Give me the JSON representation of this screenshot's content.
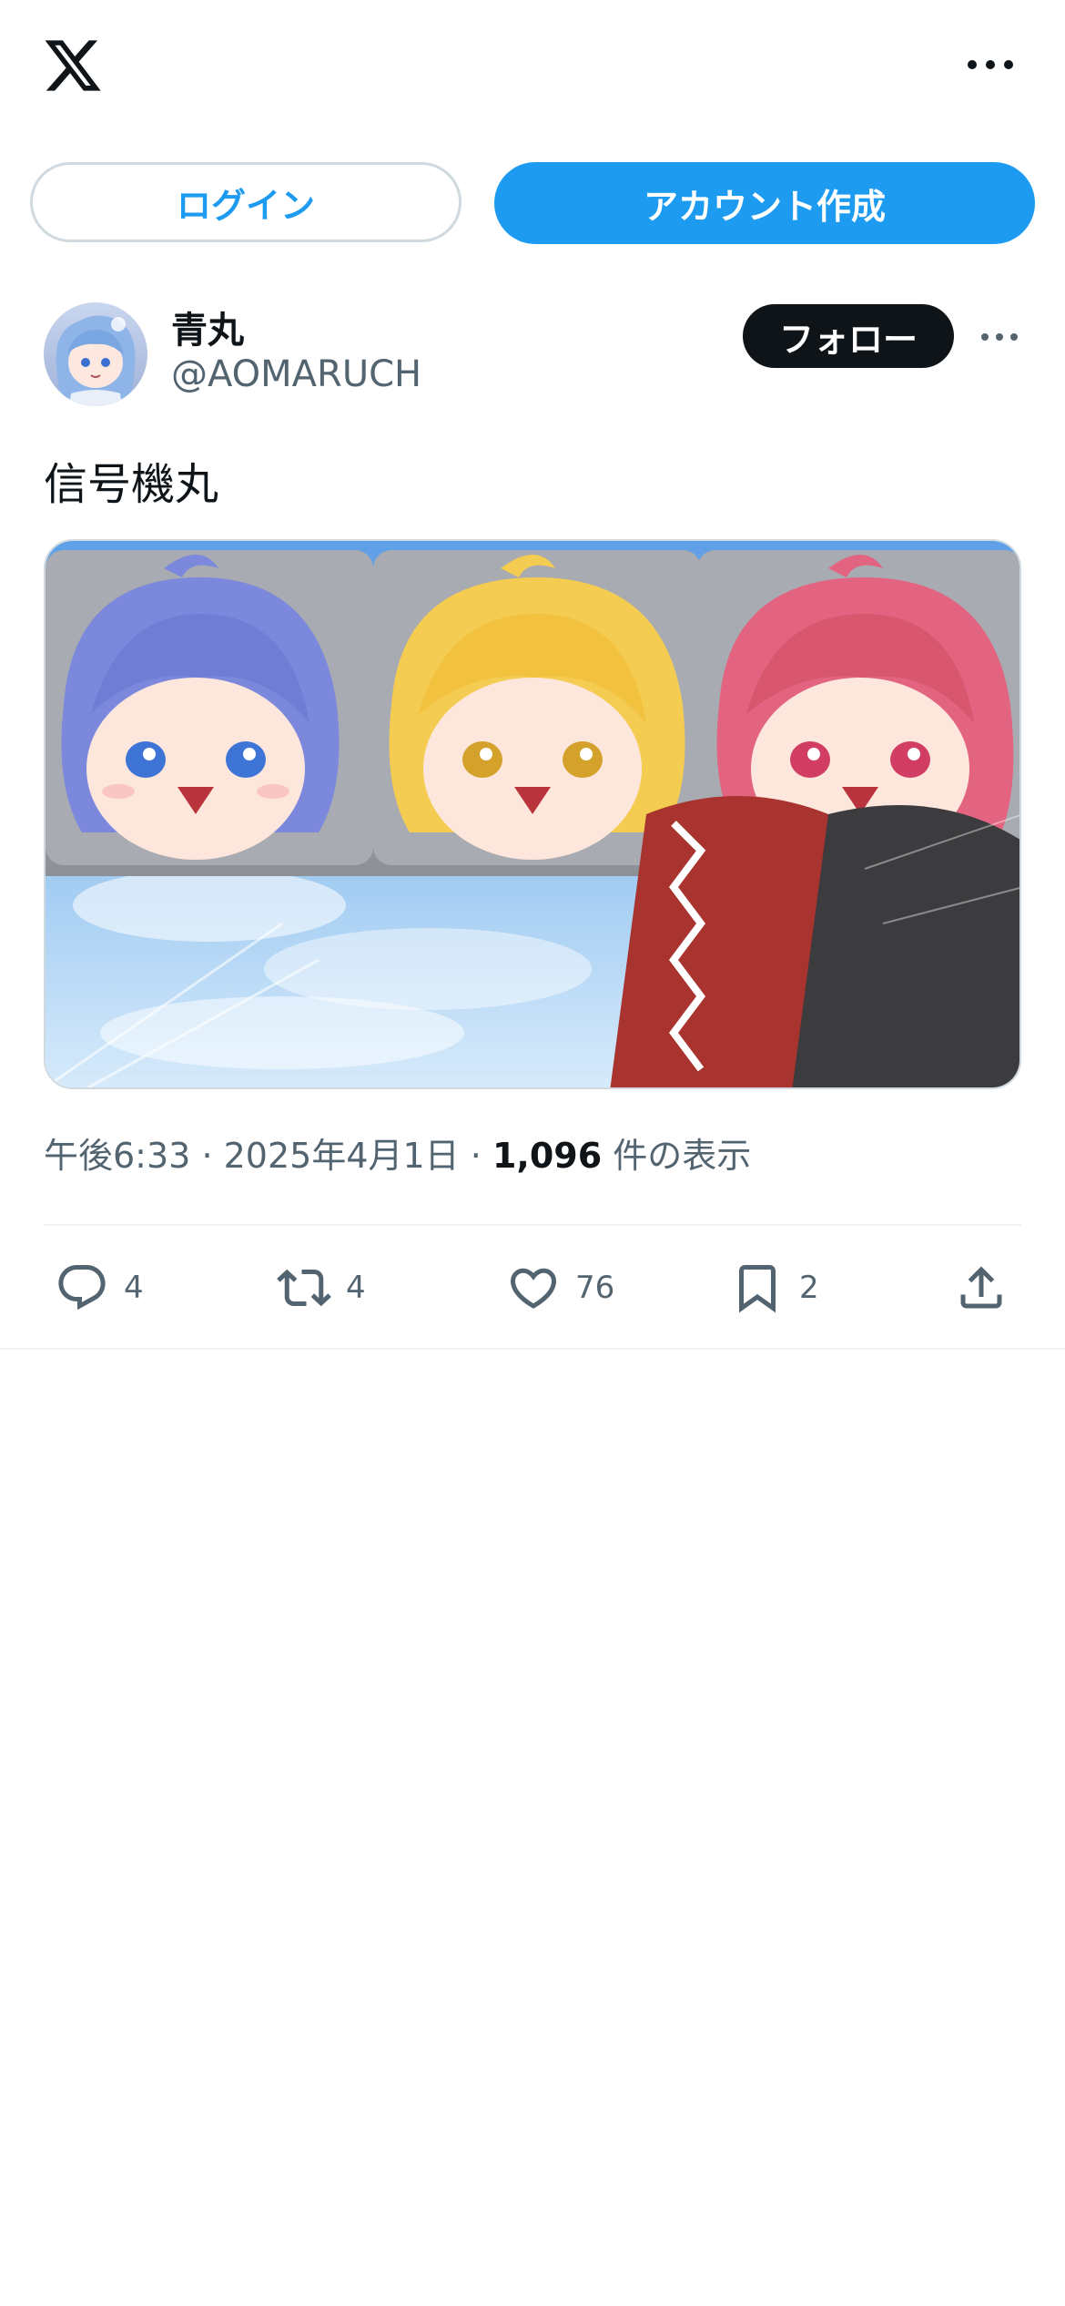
{
  "header": {
    "logo_icon": "x-logo-icon",
    "more_icon": "more-horizontal-icon"
  },
  "auth": {
    "login_label": "ログイン",
    "signup_label": "アカウント作成"
  },
  "tweet": {
    "author": {
      "display_name": "青丸",
      "handle": "@AOMARUCH",
      "follow_label": "フォロー"
    },
    "text": "信号機丸",
    "meta": {
      "time": "午後6:33",
      "separator": "·",
      "date": "2025年4月1日",
      "views_count": "1,096",
      "views_label": "件の表示"
    },
    "actions": {
      "replies": "4",
      "retweets": "4",
      "likes": "76",
      "bookmarks": "2"
    }
  },
  "colors": {
    "accent": "#1d9bf0",
    "text": "#0f1419",
    "secondary": "#536471",
    "border": "#cfd9de"
  }
}
